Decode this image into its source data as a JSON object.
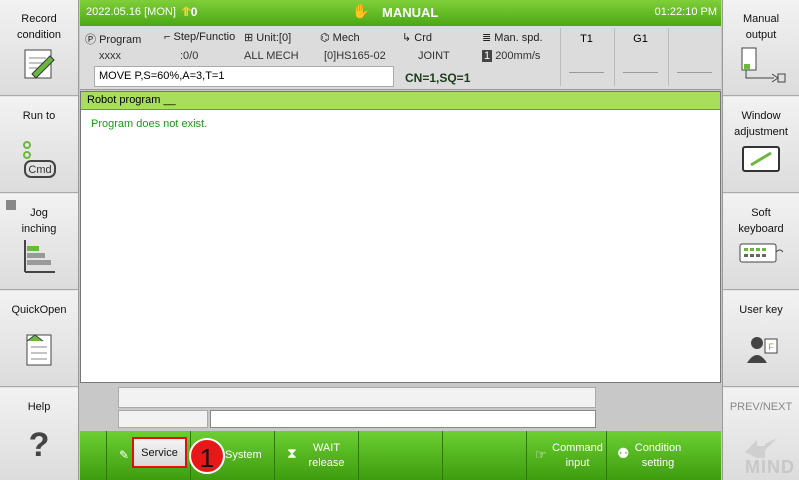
{
  "left_panel": [
    {
      "label": "Record\ncondition",
      "icon": "edit-icon"
    },
    {
      "label": "Run to",
      "icon": "cmd-icon",
      "sub": "Cmd"
    },
    {
      "label": "Jog\ninching",
      "icon": "jog-icon"
    },
    {
      "label": "QuickOpen",
      "icon": "quickopen-icon"
    },
    {
      "label": "Help",
      "icon": "question-icon"
    }
  ],
  "right_panel": [
    {
      "label": "Manual\noutput",
      "icon": "manual-output-icon"
    },
    {
      "label": "Window\nadjustment",
      "icon": "window-adjust-icon"
    },
    {
      "label": "Soft\nkeyboard",
      "icon": "keyboard-icon"
    },
    {
      "label": "User key",
      "icon": "user-key-icon"
    },
    {
      "label": "PREV/NEXT",
      "icon": "prev-next-icon"
    }
  ],
  "header": {
    "date": "2022.05.16 [MON]",
    "counter": "0",
    "mode": "MANUAL",
    "time": "01:22:10 PM"
  },
  "status": {
    "program_label": "Program",
    "program_value": "xxxx",
    "step_label": "Step/Functio",
    "step_value": ":0/0",
    "unit_label": "Unit:[0]",
    "unit_value": "ALL MECH",
    "mech_label": "Mech",
    "mech_value": "[0]HS165-02",
    "crd_label": "Crd",
    "crd_value": "JOINT",
    "spd_label": "Man. spd.",
    "spd_value": "200mm/s",
    "command_line": "MOVE P,S=60%,A=3,T=1",
    "cn_sq": "CN=1,SQ=1",
    "t1": "T1",
    "g1": "G1"
  },
  "program": {
    "title": "Robot program __",
    "message": "Program does not exist."
  },
  "menu": {
    "service": "Service",
    "system": "System",
    "wait_release": "WAIT\nrelease",
    "command_input": "Command\ninput",
    "condition_setting": "Condition\nsetting"
  },
  "callout": "1",
  "watermark": "MIND",
  "colors": {
    "accent_green": "#4aa814",
    "highlight_red": "#e01010"
  }
}
